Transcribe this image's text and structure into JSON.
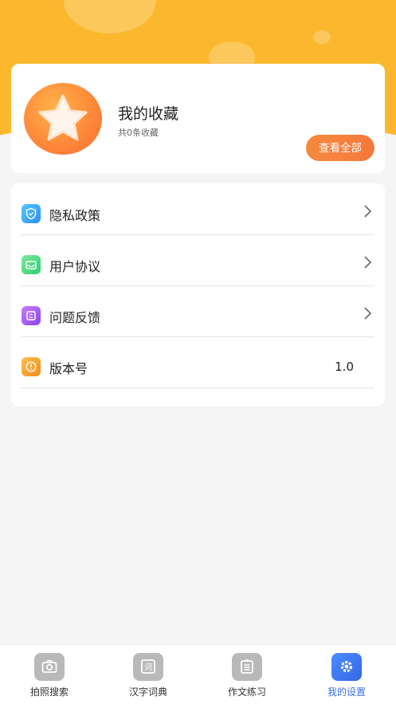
{
  "favorites": {
    "title": "我的收藏",
    "count_text": "共0条收藏",
    "view_all_label": "查看全部"
  },
  "menu": {
    "items": [
      {
        "label": "隐私政策",
        "icon": "shield-icon"
      },
      {
        "label": "用户协议",
        "icon": "envelope-icon"
      },
      {
        "label": "问题反馈",
        "icon": "feedback-icon"
      },
      {
        "label": "版本号",
        "icon": "clock-icon",
        "value": "1.0"
      }
    ]
  },
  "tabbar": {
    "tabs": [
      {
        "label": "拍照搜索",
        "icon": "camera-icon",
        "active": false
      },
      {
        "label": "汉字词典",
        "icon": "dictionary-icon",
        "active": false
      },
      {
        "label": "作文练习",
        "icon": "notepad-icon",
        "active": false
      },
      {
        "label": "我的设置",
        "icon": "gear-icon",
        "active": true
      }
    ]
  },
  "colors": {
    "header": "#fbb82e",
    "accent_button": "#f5783a",
    "active_tab": "#3b6fe5"
  }
}
